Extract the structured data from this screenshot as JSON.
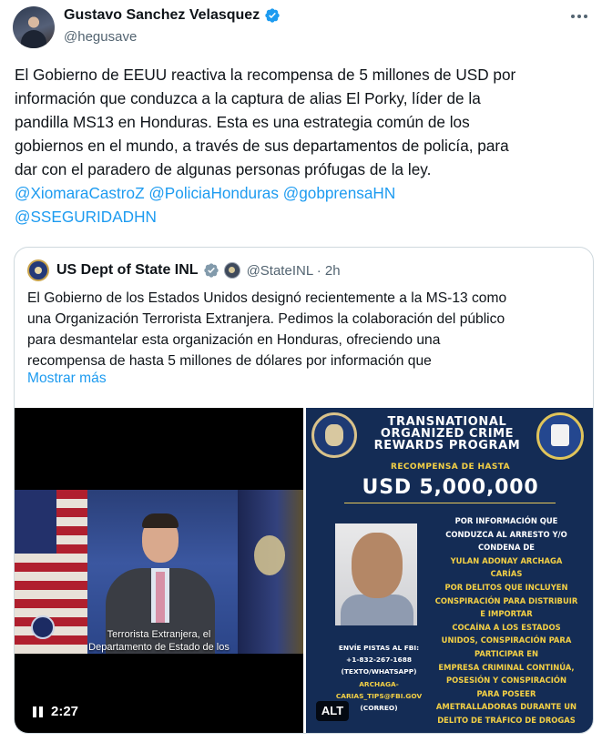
{
  "tweet": {
    "author_name": "Gustavo Sanchez Velasquez",
    "handle": "@hegusave",
    "text_lines": [
      "El Gobierno de EEUU reactiva la recompensa de 5 millones de USD por",
      "información que conduzca a la captura de alias El Porky, líder de la",
      "pandilla MS13 en Honduras. Esta es una estrategia común de los",
      "gobiernos en el mundo, a través de sus departamentos de policía, para",
      "dar con el paradero de algunas personas prófugas de la ley."
    ],
    "mentions": [
      "@XiomaraCastroZ",
      "@PoliciaHonduras",
      "@gobprensaHN",
      "@SSEGURIDADHN"
    ]
  },
  "quote": {
    "author_name": "US Dept of State INL",
    "handle_time": "@StateINL · 2h",
    "text_lines": [
      "El Gobierno de los Estados Unidos designó recientemente a la MS-13 como",
      "una Organización Terrorista Extranjera. Pedimos la colaboración del público",
      "para desmantelar esta organización en Honduras,  ofreciendo una",
      "recompensa de hasta 5 millones de dólares por información que"
    ],
    "show_more": "Mostrar más"
  },
  "video": {
    "subtitle_lines": [
      "Terrorista Extranjera, el",
      "Departamento de Estado de los"
    ],
    "duration": "2:27"
  },
  "poster": {
    "title_lines": [
      "TRANSNATIONAL",
      "ORGANIZED CRIME",
      "REWARDS PROGRAM"
    ],
    "subtitle": "RECOMPENSA DE HASTA",
    "amount": "USD 5,000,000",
    "info_white_1": [
      "POR INFORMACIÓN QUE",
      "CONDUZCA AL ARRESTO Y/O",
      "CONDENA DE"
    ],
    "suspect": [
      "YULAN ADONAY ARCHAGA",
      "CARÍAS"
    ],
    "info_white_2": [
      "POR DELITOS QUE INCLUYEN",
      "CONSPIRACIÓN PARA DISTRIBUIR",
      "E IMPORTAR"
    ],
    "charges": [
      "COCAÍNA A LOS ESTADOS",
      "UNIDOS, CONSPIRACIÓN PARA",
      "PARTICIPAR EN",
      "EMPRESA CRIMINAL CONTINÚA,",
      "POSESIÓN Y CONSPIRACIÓN",
      "PARA POSEER",
      "AMETRALLADORAS DURANTE UN",
      "DELITO DE TRÁFICO DE DROGAS"
    ],
    "tip_lines": [
      "ENVÍE PISTAS AL FBI:",
      "+1-832-267-1688",
      "(TEXTO/WHATSAPP)"
    ],
    "email_lines": [
      "ARCHAGA-",
      "CARIAS_TIPS@FBI.GOV",
      "(CORREO)"
    ],
    "alt_label": "ALT"
  },
  "colors": {
    "link": "#1d9bf0",
    "verified": "#1d9bf0",
    "poster_bg": "#142c55",
    "poster_accent": "#f4d045"
  },
  "icons": [
    "verified-badge-icon",
    "more-options-icon",
    "gray-verified-icon",
    "pause-icon"
  ]
}
